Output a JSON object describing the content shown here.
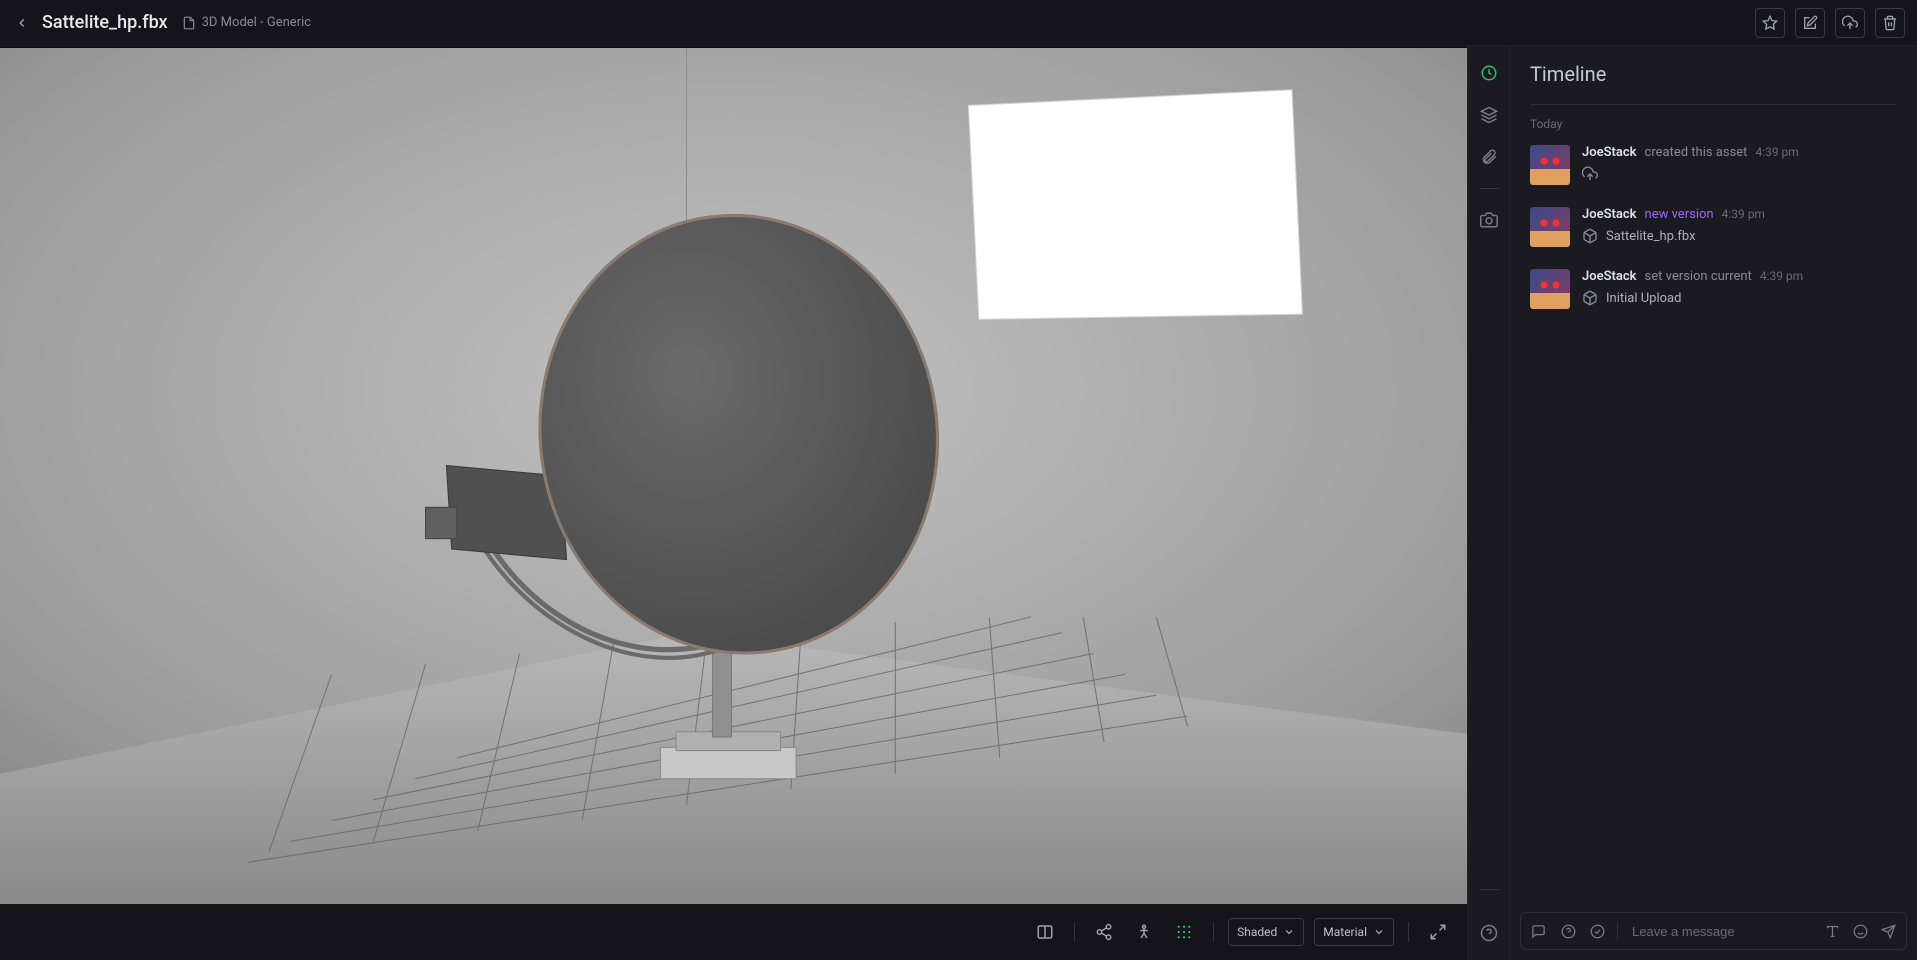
{
  "header": {
    "title": "Sattelite_hp.fbx",
    "asset_type": "3D Model - Generic"
  },
  "viewer_bar": {
    "shaded_label": "Shaded",
    "material_label": "Material"
  },
  "sidepanel": {
    "title": "Timeline",
    "section_today": "Today",
    "entries": [
      {
        "user": "JoeStack",
        "action": "created this asset",
        "action_style": "normal",
        "time": "4:39 pm",
        "sub_icon": "upload",
        "sub_text": ""
      },
      {
        "user": "JoeStack",
        "action": "new version",
        "action_style": "purple",
        "time": "4:39 pm",
        "sub_icon": "cube",
        "sub_text": "Sattelite_hp.fbx"
      },
      {
        "user": "JoeStack",
        "action": "set version current",
        "action_style": "normal",
        "time": "4:39 pm",
        "sub_icon": "cube",
        "sub_text": "Initial Upload"
      }
    ],
    "composer_placeholder": "Leave a message"
  }
}
